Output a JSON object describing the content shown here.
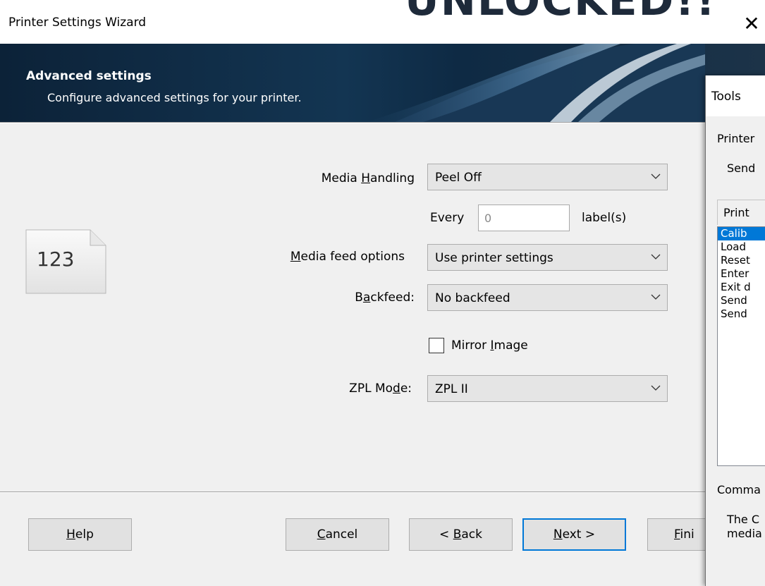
{
  "window": {
    "title": "Printer Settings Wizard",
    "background_text": "UNLOCKED!!"
  },
  "header": {
    "title": "Advanced settings",
    "subtitle": "Configure advanced settings for your printer."
  },
  "icon": {
    "label": "123"
  },
  "form": {
    "media_handling": {
      "label_pre": "Media ",
      "label_key": "H",
      "label_post": "andling",
      "value": "Peel Off"
    },
    "every": {
      "label": "Every",
      "value": "0",
      "suffix": "label(s)"
    },
    "media_feed": {
      "label_key": "M",
      "label_post": "edia feed options",
      "value": "Use printer settings"
    },
    "backfeed": {
      "label_pre": "B",
      "label_key": "a",
      "label_post": "ckfeed:",
      "value": "No backfeed"
    },
    "mirror": {
      "label_pre": "Mirror ",
      "label_key": "I",
      "label_post": "mage",
      "checked": false
    },
    "zpl_mode": {
      "label_pre": "ZPL Mo",
      "label_key": "d",
      "label_post": "e:",
      "value": "ZPL II"
    }
  },
  "buttons": {
    "help": {
      "key": "H",
      "rest": "elp"
    },
    "cancel": {
      "key": "C",
      "rest": "ancel"
    },
    "back": {
      "pre": "< ",
      "key": "B",
      "rest": "ack"
    },
    "next": {
      "key": "N",
      "rest": "ext >"
    },
    "finish": {
      "key": "F",
      "rest": "ini"
    }
  },
  "tools": {
    "title": "Tools",
    "printer_label": "Printer",
    "send_label": "Send",
    "tab_label": "Print",
    "list_items": [
      "Calib",
      "Load",
      "Reset",
      "Enter",
      "Exit d",
      "Send",
      "Send"
    ],
    "selected_index": 0,
    "command_label": "Comma",
    "description_line1": "The C",
    "description_line2": "media"
  }
}
